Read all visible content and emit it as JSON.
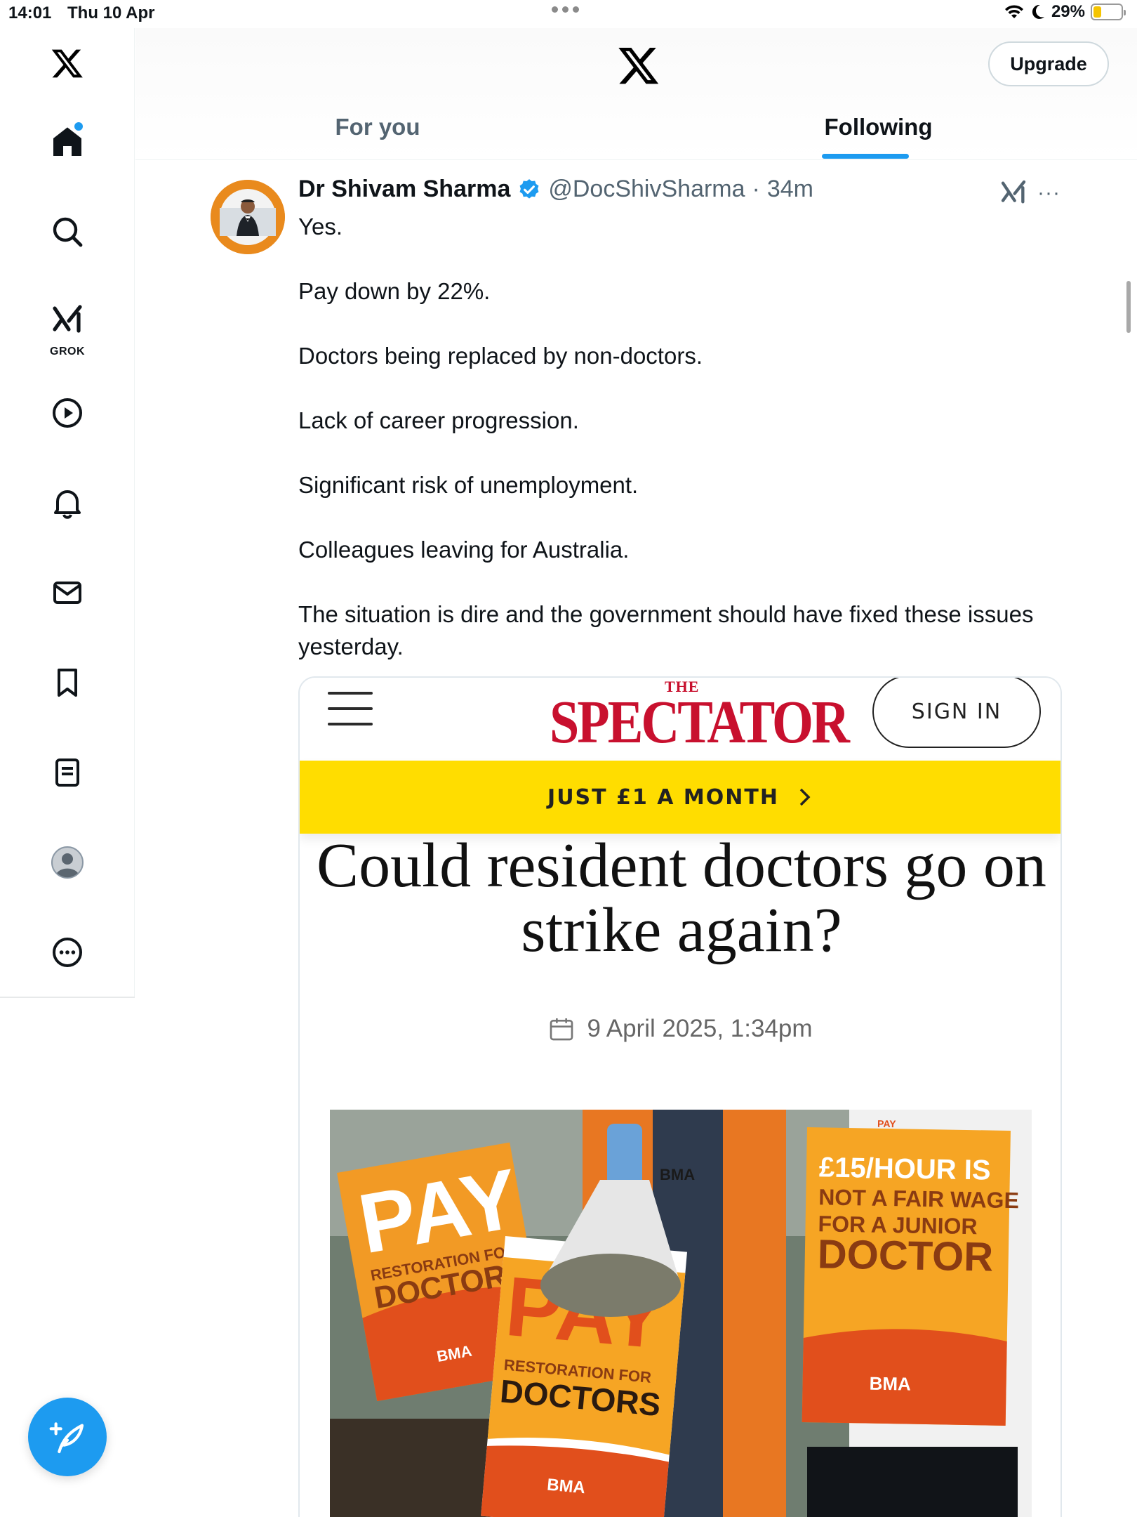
{
  "status_bar": {
    "time": "14:01",
    "date": "Thu 10 Apr",
    "battery_percent": "29%",
    "battery_level": 0.29,
    "icons": [
      "wifi-icon",
      "moon-icon",
      "battery-icon"
    ]
  },
  "sidebar": {
    "items": [
      {
        "name": "x-logo",
        "icon": "x-logo-icon"
      },
      {
        "name": "home",
        "icon": "home-icon",
        "badge": true
      },
      {
        "name": "search",
        "icon": "search-icon"
      },
      {
        "name": "grok",
        "icon": "grok-icon",
        "label": "GROK"
      },
      {
        "name": "video",
        "icon": "play-icon"
      },
      {
        "name": "notifications",
        "icon": "bell-icon"
      },
      {
        "name": "messages",
        "icon": "mail-icon"
      },
      {
        "name": "bookmarks",
        "icon": "bookmark-icon"
      },
      {
        "name": "lists",
        "icon": "list-icon"
      },
      {
        "name": "profile",
        "icon": "profile-icon"
      },
      {
        "name": "more",
        "icon": "more-icon"
      }
    ],
    "compose_icon": "compose-icon"
  },
  "header": {
    "upgrade_label": "Upgrade",
    "tabs": [
      {
        "label": "For you",
        "active": false
      },
      {
        "label": "Following",
        "active": true
      }
    ],
    "accent_color": "#1d9bf0"
  },
  "post": {
    "author_name": "Dr Shivam Sharma",
    "handle": "@DocShivSharma",
    "separator": "·",
    "time": "34m",
    "verified": true,
    "more": "···",
    "paragraphs": [
      "Yes.",
      "Pay down by 22%.",
      "Doctors being replaced by non-doctors.",
      "Lack of career progression.",
      "Significant risk of unemployment.",
      "Colleagues leaving for Australia.",
      "The situation is dire and the government should have fixed these issues yesterday."
    ]
  },
  "card": {
    "brand_small": "THE",
    "brand": "SPECTATOR",
    "sign_in": "SIGN IN",
    "promo": "JUST £1 A MONTH",
    "headline": "Could resident doctors go on strike again?",
    "date": "9 April 2025, 1:34pm",
    "brand_color": "#c8102e",
    "promo_color": "#ffdd00",
    "image_placards": [
      {
        "big": "PAY",
        "small": "RESTORATION FOR",
        "word": "DOCTORS",
        "org": "BMA"
      },
      {
        "big": "PAY",
        "small": "RESTORATION FOR",
        "word": "DOCTORS",
        "org": "BMA"
      },
      {
        "top": "PAY",
        "lines": [
          "£15/HOUR IS",
          "NOT A FAIR WAGE",
          "FOR A JUNIOR",
          "DOCTOR"
        ],
        "org": "BMA"
      }
    ],
    "vest_label": "BMA"
  }
}
